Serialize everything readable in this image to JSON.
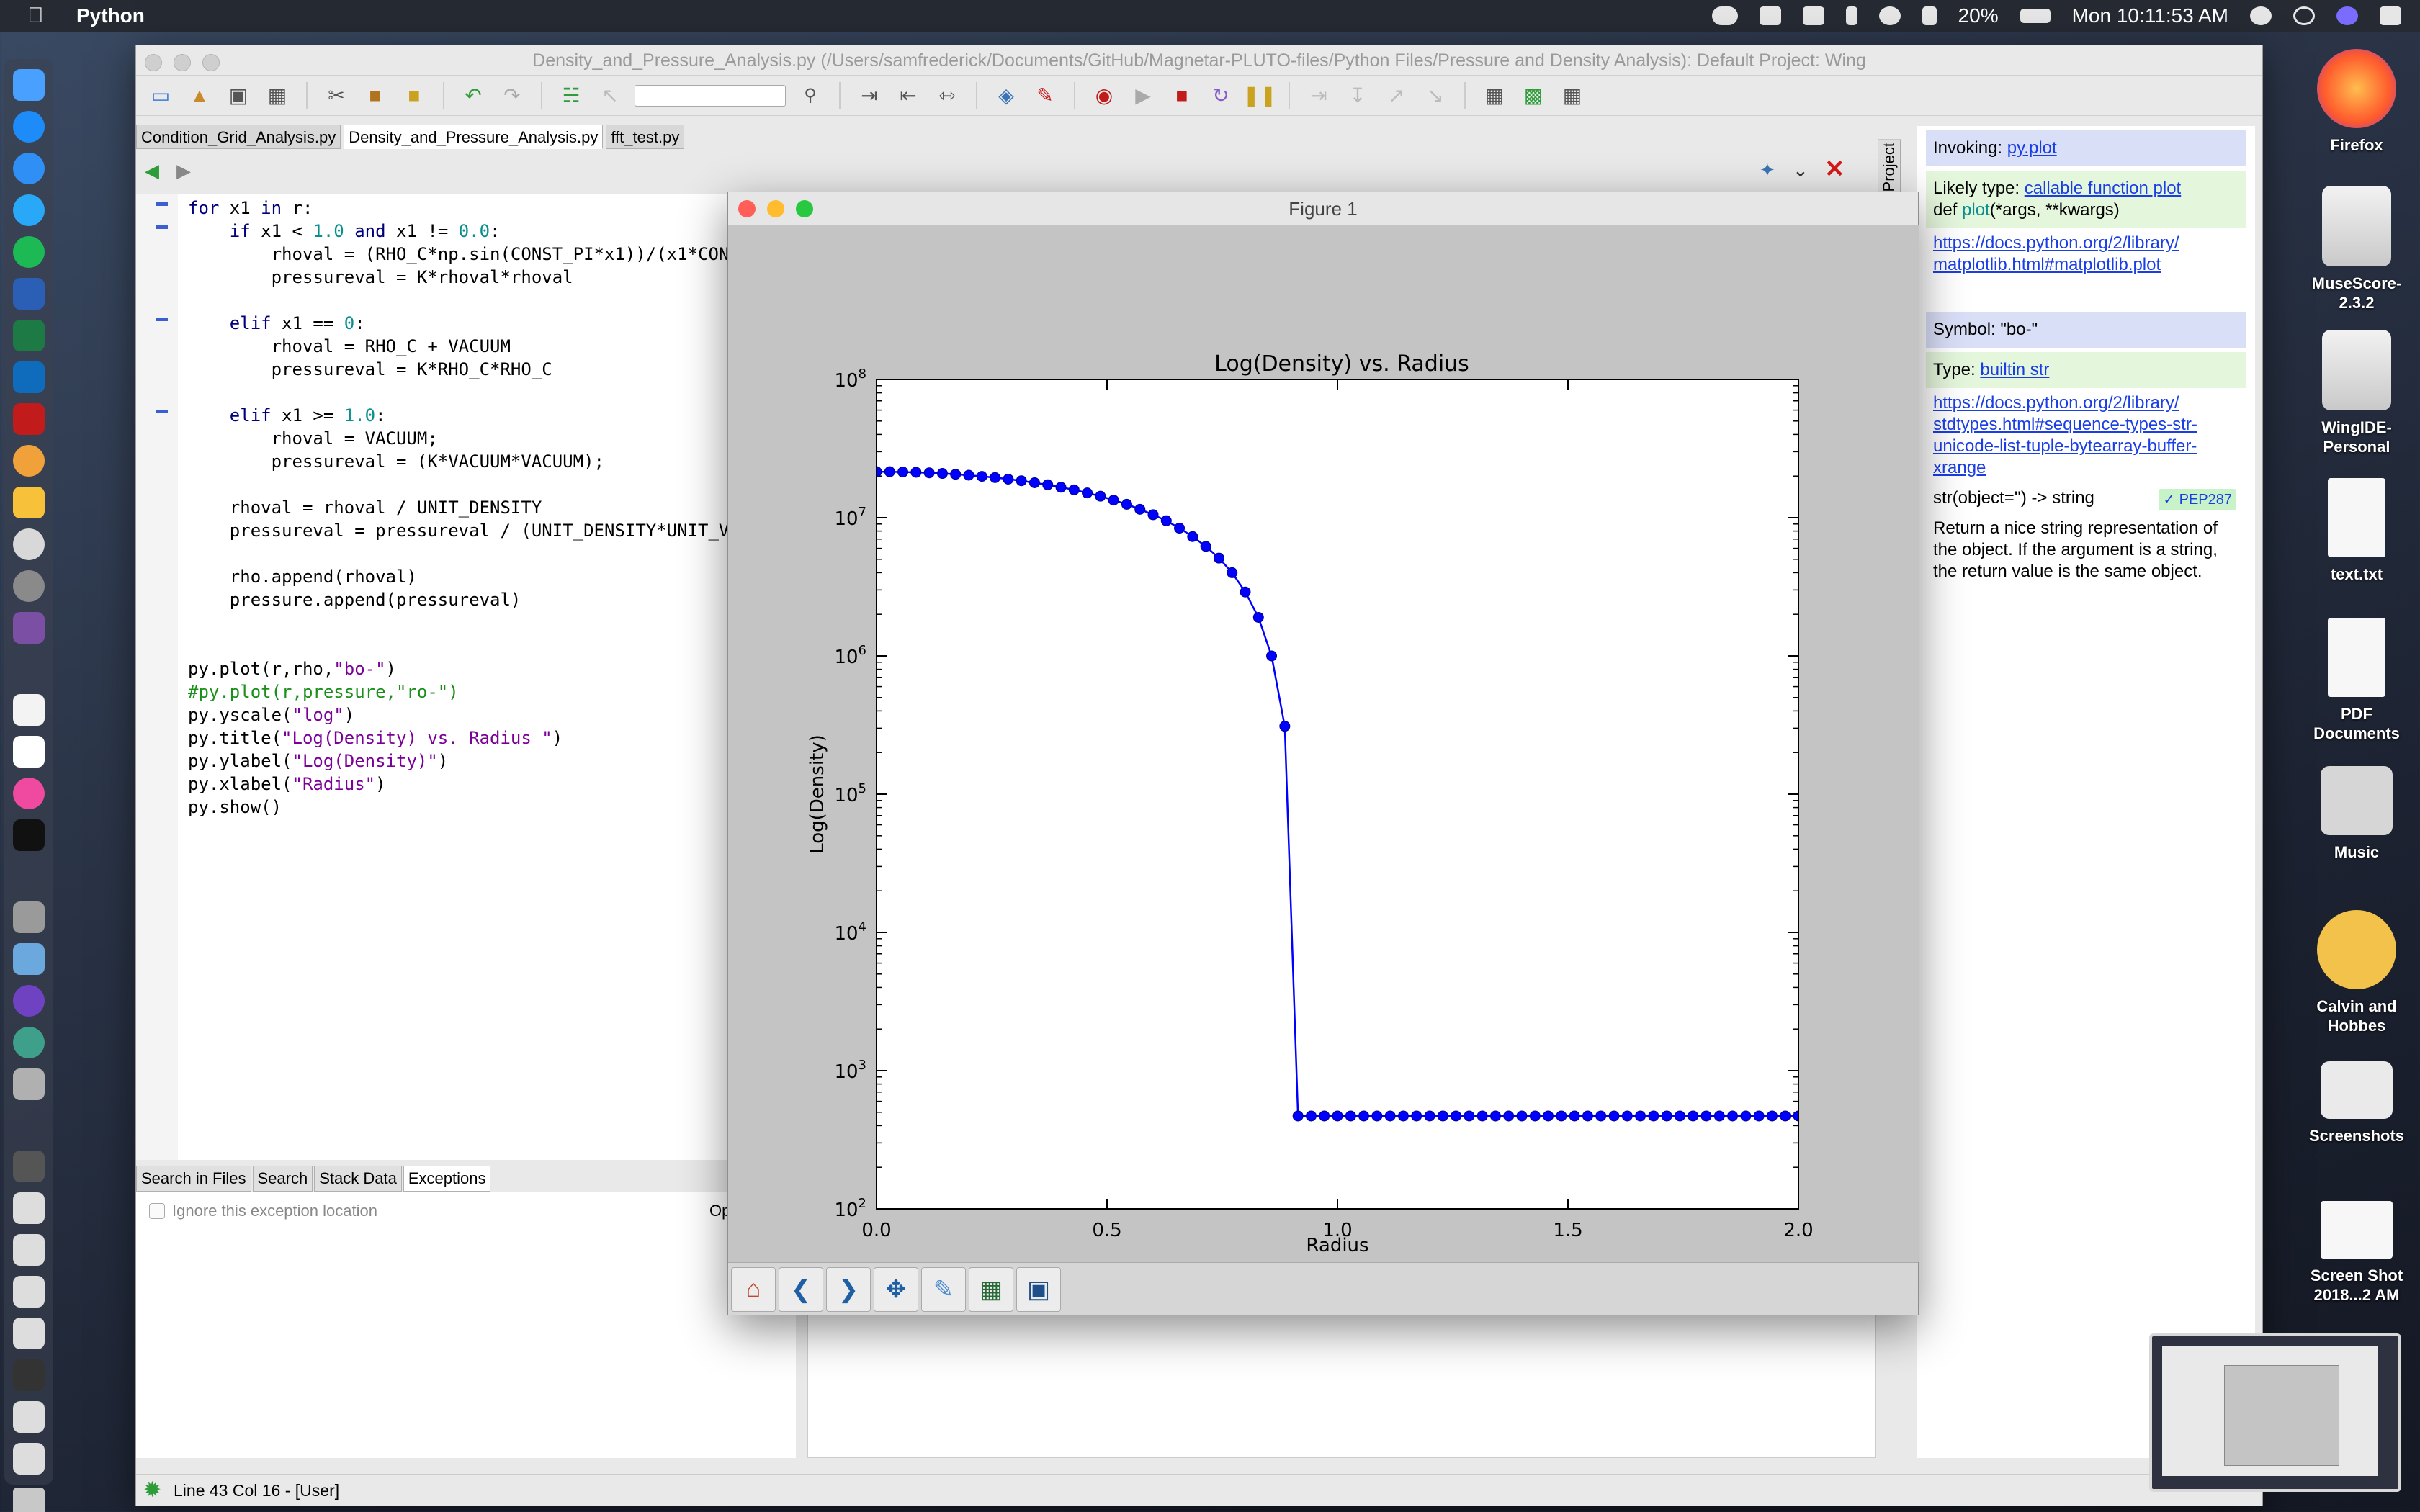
{
  "menubar": {
    "app_name": "Python",
    "battery": "20%",
    "clock": "Mon 10:11:53 AM"
  },
  "wing": {
    "title": "Density_and_Pressure_Analysis.py (/Users/samfrederick/Documents/GitHub/Magnetar-PLUTO-files/Python Files/Pressure and Density Analysis): Default Project: Wing",
    "tabs": [
      "Condition_Grid_Analysis.py",
      "Density_and_Pressure_Analysis.py",
      "fft_test.py"
    ],
    "side_tab": "Project",
    "status": "Line 43 Col 16 - [User]"
  },
  "code": [
    "for x1 in r:",
    "    if x1 < 1.0 and x1 != 0.0:",
    "        rhoval = (RHO_C*np.sin(CONST_PI*x1))/(x1*CON",
    "        pressureval = K*rhoval*rhoval",
    "",
    "    elif x1 == 0:",
    "        rhoval = RHO_C + VACUUM",
    "        pressureval = K*RHO_C*RHO_C",
    "",
    "    elif x1 >= 1.0:",
    "        rhoval = VACUUM;",
    "        pressureval = (K*VACUUM*VACUUM);",
    "",
    "    rhoval = rhoval / UNIT_DENSITY",
    "    pressureval = pressureval / (UNIT_DENSITY*UNIT_V",
    "",
    "    rho.append(rhoval)",
    "    pressure.append(pressureval)",
    "",
    "",
    "py.plot(r,rho,\"bo-\")",
    "#py.plot(r,pressure,\"ro-\")",
    "py.yscale(\"log\")",
    "py.title(\"Log(Density) vs. Radius \")",
    "py.ylabel(\"Log(Density)\")",
    "py.xlabel(\"Radius\")",
    "py.show()"
  ],
  "bottom": {
    "tabs": [
      "Search in Files",
      "Search",
      "Stack Data",
      "Exceptions"
    ],
    "ignore_label": "Ignore this exception location",
    "op_label": "Op"
  },
  "assistant": {
    "invoking_label": "Invoking:",
    "invoking_link": "py.plot",
    "likely_label": "Likely type:",
    "likely_link": "callable function plot",
    "def_kw": "def ",
    "def_name": "plot",
    "def_args": "(*args, **kwargs)",
    "doc_link1a": "https://docs.python.org/2/library/",
    "doc_link1b": "matplotlib.html#matplotlib.plot",
    "symbol": "Symbol: \"bo-\"",
    "type_label": "Type:",
    "type_link": "builtin str",
    "doc_link2a": "https://docs.python.org/2/library/",
    "doc_link2b": "stdtypes.html#sequence-types-str-",
    "doc_link2c": "unicode-list-tuple-bytearray-buffer-",
    "doc_link2d": "xrange",
    "sig": "str(object='') -> string",
    "pep": "✓ PEP287",
    "desc": "Return a nice string representation of the object. If the argument is a string, the return value is the same object."
  },
  "figure": {
    "window_title": "Figure 1"
  },
  "chart_data": {
    "type": "line",
    "title": "Log(Density) vs. Radius",
    "xlabel": "Radius",
    "ylabel": "Log(Density)",
    "xlim": [
      0.0,
      2.0
    ],
    "ylim": [
      100,
      100000000
    ],
    "yscale": "log",
    "xticks": [
      "0.0",
      "0.5",
      "1.0",
      "1.5",
      "2.0"
    ],
    "yticks": [
      "10^2",
      "10^3",
      "10^4",
      "10^5",
      "10^6",
      "10^7",
      "10^8"
    ],
    "color": "#0000ff",
    "x": [
      0.0,
      0.0286,
      0.0571,
      0.0857,
      0.1143,
      0.1429,
      0.1714,
      0.2,
      0.2286,
      0.2571,
      0.2857,
      0.3143,
      0.3429,
      0.3714,
      0.4,
      0.4286,
      0.4571,
      0.4857,
      0.5143,
      0.5429,
      0.5714,
      0.6,
      0.6286,
      0.6571,
      0.6857,
      0.7143,
      0.7429,
      0.7714,
      0.8,
      0.8286,
      0.8571,
      0.8857,
      0.9143,
      0.9429,
      0.9714,
      1.0,
      1.0286,
      1.0571,
      1.0857,
      1.1143,
      1.1429,
      1.1714,
      1.2,
      1.2286,
      1.2571,
      1.2857,
      1.3143,
      1.3429,
      1.3714,
      1.4,
      1.4286,
      1.4571,
      1.4857,
      1.5143,
      1.5429,
      1.5714,
      1.6,
      1.6286,
      1.6571,
      1.6857,
      1.7143,
      1.7429,
      1.7714,
      1.8,
      1.8286,
      1.8571,
      1.8857,
      1.9143,
      1.9429,
      1.9714,
      2.0
    ],
    "y": [
      21500000,
      21500000,
      21400000,
      21300000,
      21100000,
      20900000,
      20600000,
      20300000,
      19900000,
      19500000,
      19000000,
      18500000,
      17900000,
      17300000,
      16600000,
      15900000,
      15100000,
      14300000,
      13400000,
      12500000,
      11500000,
      10500000,
      9500000,
      8400000,
      7300000,
      6200000,
      5100000,
      4000000,
      2900000,
      1900000,
      1000000,
      310000,
      470,
      470,
      470,
      470,
      470,
      470,
      470,
      470,
      470,
      470,
      470,
      470,
      470,
      470,
      470,
      470,
      470,
      470,
      470,
      470,
      470,
      470,
      470,
      470,
      470,
      470,
      470,
      470,
      470,
      470,
      470,
      470,
      470,
      470,
      470,
      470,
      470,
      470,
      470
    ]
  }
}
